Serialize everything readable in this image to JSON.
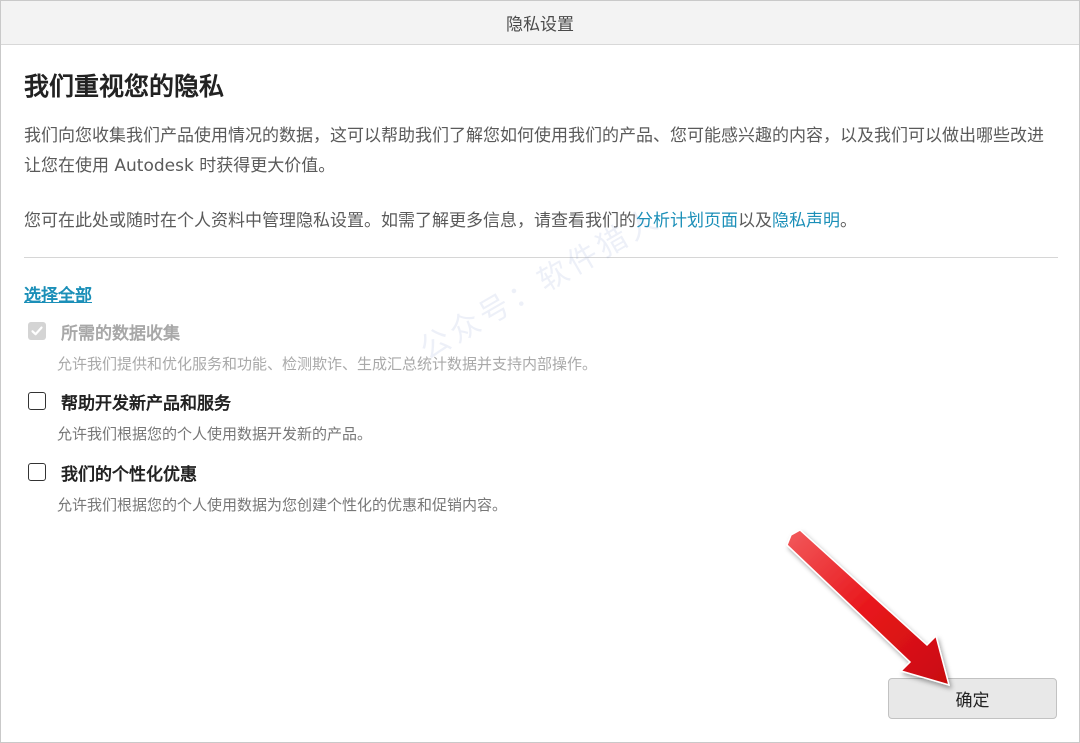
{
  "window": {
    "title": "隐私设置"
  },
  "main": {
    "heading": "我们重视您的隐私",
    "paragraph1": "我们向您收集我们产品使用情况的数据，这可以帮助我们了解您如何使用我们的产品、您可能感兴趣的内容，以及我们可以做出哪些改进让您在使用 Autodesk 时获得更大价值。",
    "paragraph2_prefix": "您可在此处或随时在个人资料中管理隐私设置。如需了解更多信息，请查看我们的",
    "analytics_link": "分析计划页面",
    "paragraph2_middle": "以及",
    "privacy_link": "隐私声明",
    "paragraph2_suffix": "。",
    "select_all": "选择全部"
  },
  "options": [
    {
      "title": "所需的数据收集",
      "description": "允许我们提供和优化服务和功能、检测欺诈、生成汇总统计数据并支持内部操作。",
      "checked": true,
      "disabled": true
    },
    {
      "title": "帮助开发新产品和服务",
      "description": "允许我们根据您的个人使用数据开发新的产品。",
      "checked": false,
      "disabled": false
    },
    {
      "title": "我们的个性化优惠",
      "description": "允许我们根据您的个人使用数据为您创建个性化的优惠和促销内容。",
      "checked": false,
      "disabled": false
    }
  ],
  "footer": {
    "ok_label": "确定"
  },
  "watermark": "公众号：软件猎人",
  "colors": {
    "link": "#1b8fb8",
    "arrow": "#e8161b",
    "titlebar": "#f3f3f3",
    "button": "#e8e8e8"
  }
}
